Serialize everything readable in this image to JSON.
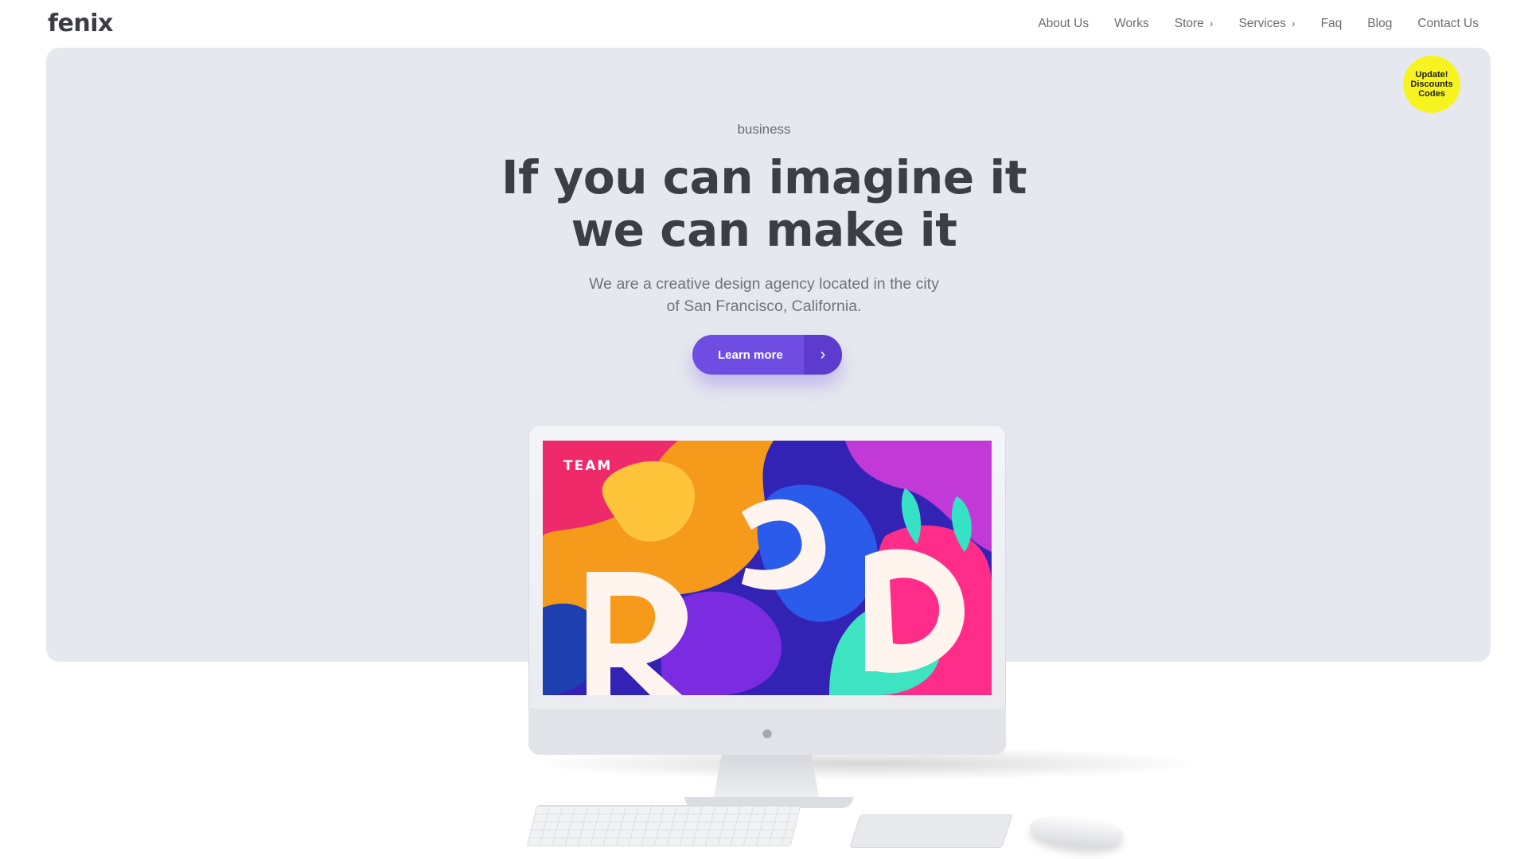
{
  "brand": {
    "name": "fenix",
    "accent": "#f5a623"
  },
  "nav": {
    "items": [
      {
        "label": "About Us"
      },
      {
        "label": "Works"
      },
      {
        "label": "Store",
        "has_submenu": true
      },
      {
        "label": "Services",
        "has_submenu": true
      },
      {
        "label": "Faq"
      },
      {
        "label": "Blog"
      },
      {
        "label": "Contact Us"
      }
    ],
    "submenu_icon": "chevron-right-icon"
  },
  "badge": {
    "line1": "Update!",
    "line2": "Discounts",
    "line3": "Codes",
    "color": "#f7f321"
  },
  "hero": {
    "eyebrow": "business",
    "headline_line1": "If you can imagine it",
    "headline_line2": "we can make it",
    "subtitle_line1": "We are a creative design agency located in the city",
    "subtitle_line2": "of San Francisco, California.",
    "cta_label": "Learn more",
    "cta_icon": "chevron-right-icon",
    "cta_color": "#6f4de3",
    "background": "#e6e8ef"
  },
  "mockup": {
    "screen_label": "TEAM",
    "device_icon": "apple-logo-icon",
    "letters": [
      "R",
      "D",
      "D"
    ]
  }
}
